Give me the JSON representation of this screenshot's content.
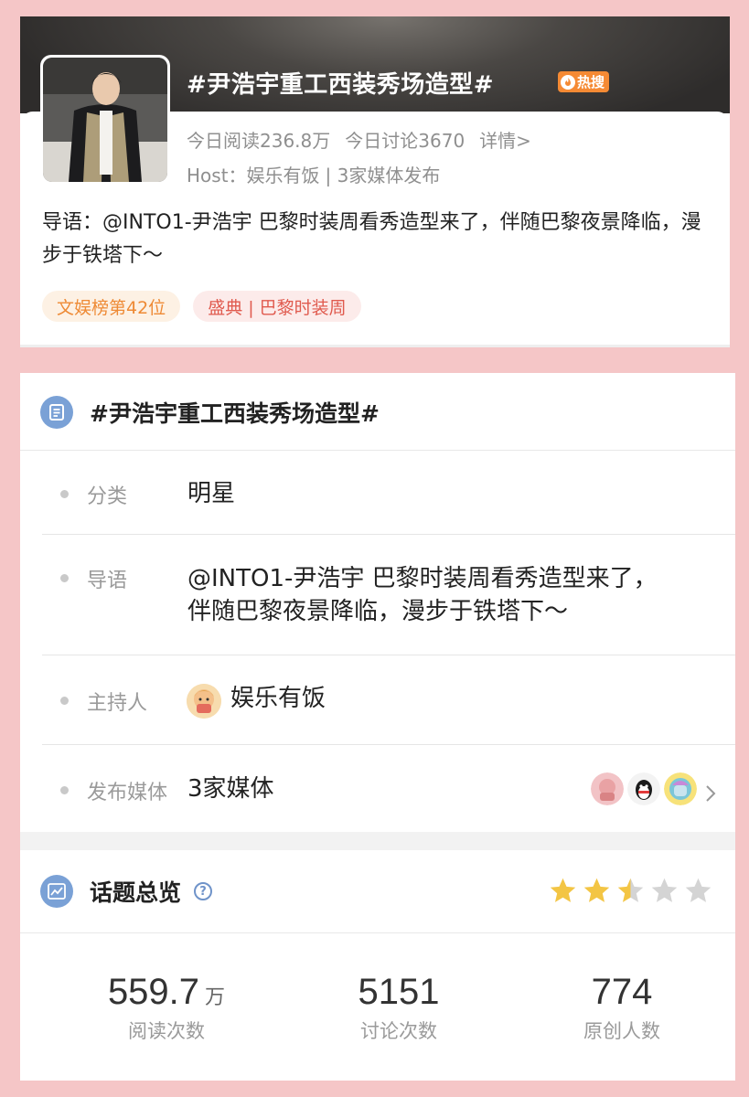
{
  "topic": {
    "title": "#尹浩宇重工西装秀场造型#",
    "hot_badge": "热搜",
    "read_today": "今日阅读236.8万",
    "discuss_today": "今日讨论3670",
    "details_link": "详情>",
    "host_line": "Host：娱乐有饭",
    "media_line": "| 3家媒体发布",
    "intro": "导语：@INTO1-尹浩宇 巴黎时装周看秀造型来了，伴随巴黎夜景降临，漫步于铁塔下～",
    "tags": [
      "文娱榜第42位",
      "盛典 | 巴黎时装周"
    ]
  },
  "detail": {
    "title": "#尹浩宇重工西装秀场造型#",
    "rows": {
      "category": {
        "label": "分类",
        "value": "明星"
      },
      "intro": {
        "label": "导语",
        "value_line1": "@INTO1-尹浩宇 巴黎时装周看秀造型来了，",
        "value_line2": "伴随巴黎夜景降临，漫步于铁塔下～"
      },
      "host": {
        "label": "主持人",
        "value": "娱乐有饭"
      },
      "media": {
        "label": "发布媒体",
        "value": "3家媒体"
      }
    }
  },
  "overview": {
    "title": "话题总览",
    "help_icon": "?",
    "rating": 2.5,
    "rating_max": 5,
    "metrics": [
      {
        "value": "559.7",
        "unit": "万",
        "caption": "阅读次数"
      },
      {
        "value": "5151",
        "unit": "",
        "caption": "讨论次数"
      },
      {
        "value": "774",
        "unit": "",
        "caption": "原创人数"
      }
    ]
  },
  "colors": {
    "background": "#f5c6c7",
    "hot_badge": "#f58a34",
    "tag_rank_text": "#ee8a35",
    "tag_event_text": "#e05a4e",
    "section_icon": "#7aa1d6",
    "star_filled": "#f3c544",
    "star_empty": "#d4d4d4"
  },
  "icons": [
    "hot-flame-icon",
    "list-icon",
    "chart-icon",
    "help-icon",
    "star-icon",
    "chevron-right-icon"
  ]
}
